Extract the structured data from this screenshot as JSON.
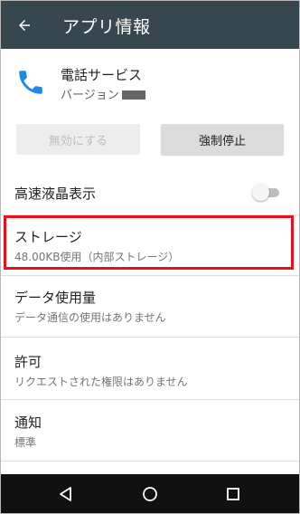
{
  "appbar": {
    "title": "アプリ情報",
    "back_icon": "arrow-back-icon"
  },
  "app": {
    "name": "電話サービス",
    "version_label": "バージョン",
    "icon": "phone-icon",
    "icon_color": "#1e88e5"
  },
  "buttons": {
    "disable_label": "無効にする",
    "force_stop_label": "強制停止"
  },
  "settings": {
    "fast_lcd_label": "高速液晶表示",
    "fast_lcd_on": false
  },
  "items": [
    {
      "title": "ストレージ",
      "subtitle": "48.00KB使用（内部ストレージ）"
    },
    {
      "title": "データ使用量",
      "subtitle": "データ通信の使用はありません"
    },
    {
      "title": "許可",
      "subtitle": "リクエストされた権限はありません"
    },
    {
      "title": "通知",
      "subtitle": "標準"
    }
  ],
  "colors": {
    "appbar": "#37474f",
    "highlight": "#e8101c",
    "navbar": "#111111"
  },
  "navbar": {
    "back": "nav-back-icon",
    "home": "nav-home-icon",
    "recents": "nav-recents-icon"
  }
}
